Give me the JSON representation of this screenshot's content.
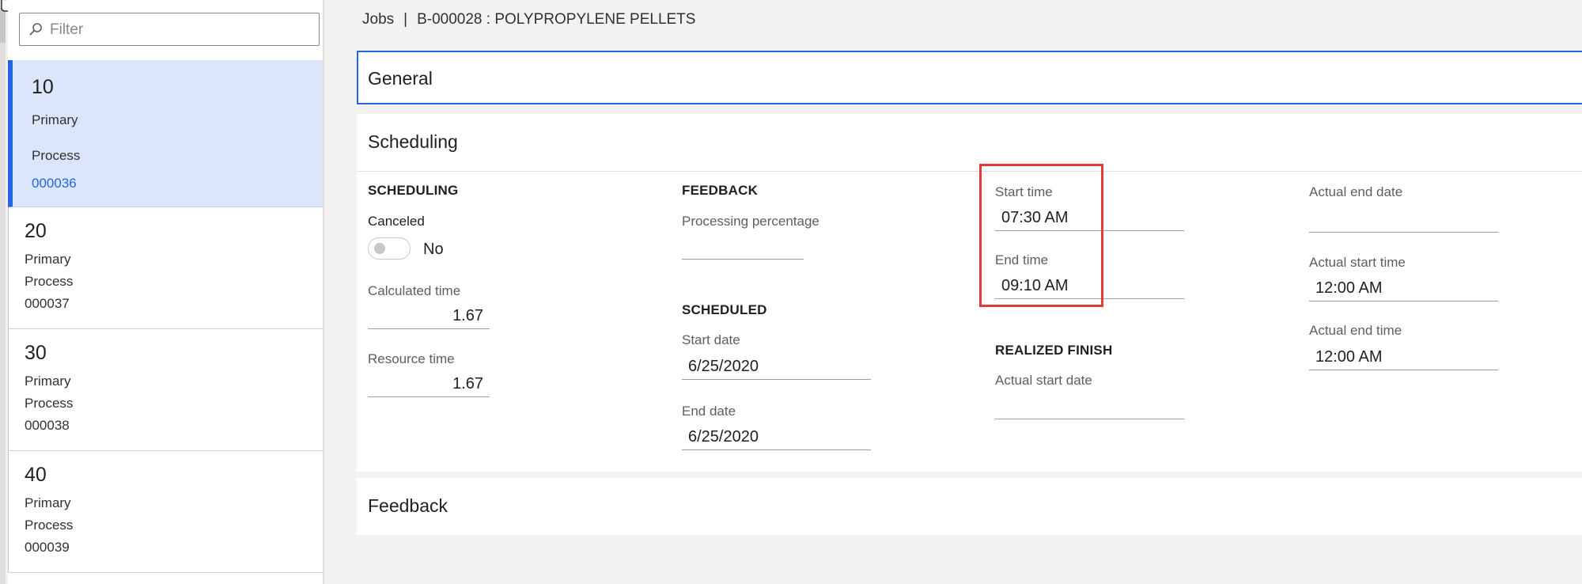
{
  "filter": {
    "placeholder": "Filter"
  },
  "jobs_list": [
    {
      "number": "10",
      "type": "Primary",
      "category": "Process",
      "id": "000036",
      "selected": true
    },
    {
      "number": "20",
      "type": "Primary",
      "category": "Process",
      "id": "000037"
    },
    {
      "number": "30",
      "type": "Primary",
      "category": "Process",
      "id": "000038"
    },
    {
      "number": "40",
      "type": "Primary",
      "category": "Process",
      "id": "000039"
    }
  ],
  "breadcrumb": {
    "root": "Jobs",
    "separator": "|",
    "current": "B-000028 : POLYPROPYLENE PELLETS"
  },
  "sections": {
    "general": "General",
    "scheduling": "Scheduling",
    "feedback": "Feedback"
  },
  "scheduling": {
    "scheduling_group": {
      "heading": "SCHEDULING",
      "canceled_label": "Canceled",
      "canceled_value": "No",
      "calculated_time_label": "Calculated time",
      "calculated_time_value": "1.67",
      "resource_time_label": "Resource time",
      "resource_time_value": "1.67"
    },
    "feedback_group": {
      "heading": "FEEDBACK",
      "processing_percentage_label": "Processing percentage",
      "processing_percentage_value": ""
    },
    "scheduled_group": {
      "heading": "SCHEDULED",
      "start_date_label": "Start date",
      "start_date_value": "6/25/2020",
      "end_date_label": "End date",
      "end_date_value": "6/25/2020"
    },
    "times_group": {
      "start_time_label": "Start time",
      "start_time_value": "07:30 AM",
      "end_time_label": "End time",
      "end_time_value": "09:10 AM"
    },
    "realized_finish_group": {
      "heading": "REALIZED FINISH",
      "actual_start_date_label": "Actual start date",
      "actual_start_date_value": ""
    },
    "actual_group": {
      "actual_end_date_label": "Actual end date",
      "actual_end_date_value": "",
      "actual_start_time_label": "Actual start time",
      "actual_start_time_value": "12:00 AM",
      "actual_end_time_label": "Actual end time",
      "actual_end_time_value": "12:00 AM"
    }
  },
  "colors": {
    "accent": "#2266e3",
    "selected_row_bg": "#dbe6fc",
    "highlight_border": "#e03a3a",
    "page_bg": "#f3f2f1"
  },
  "icons": {
    "search": "search-icon",
    "cursor": "hand-cursor-icon"
  }
}
